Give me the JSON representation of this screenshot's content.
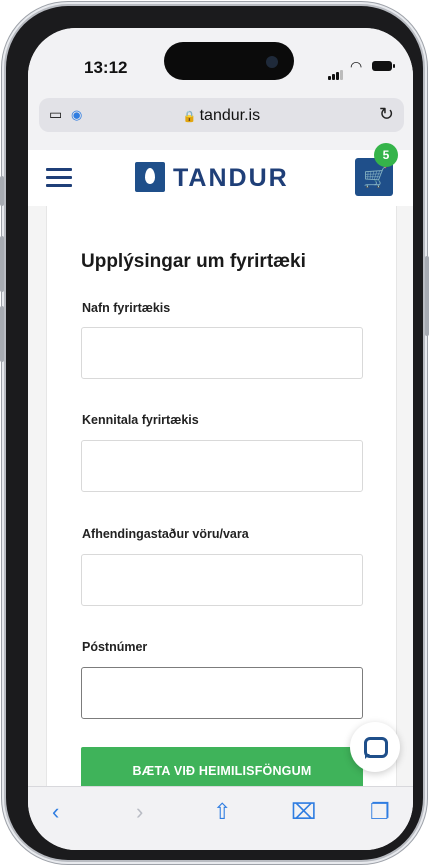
{
  "status_bar": {
    "time": "13:12"
  },
  "browser": {
    "url": "tandur.is",
    "lock_icon": "lock-icon",
    "reload_icon": "reload-icon",
    "tabs_icon": "page-settings-icon",
    "privacy_icon": "privacy-eye-icon"
  },
  "header": {
    "logo_text": "TANDUR",
    "cart_count": "5"
  },
  "form": {
    "title": "Upplýsingar um fyrirtæki",
    "fields": [
      {
        "label": "Nafn fyrirtækis",
        "value": ""
      },
      {
        "label": "Kennitala fyrirtækis",
        "value": ""
      },
      {
        "label": "Afhendingastaður vöru/vara",
        "value": ""
      },
      {
        "label": "Póstnúmer",
        "value": ""
      }
    ],
    "submit_label": "BÆTA VIÐ HEIMILISFÖNGUM"
  },
  "toolbar": {
    "back": "‹",
    "forward": "›",
    "share": "⇧",
    "bookmarks": "⌧",
    "tabs": "❐"
  },
  "colors": {
    "brand": "#1f4f8a",
    "accent": "#3fb35a",
    "link": "#2f7de1"
  }
}
